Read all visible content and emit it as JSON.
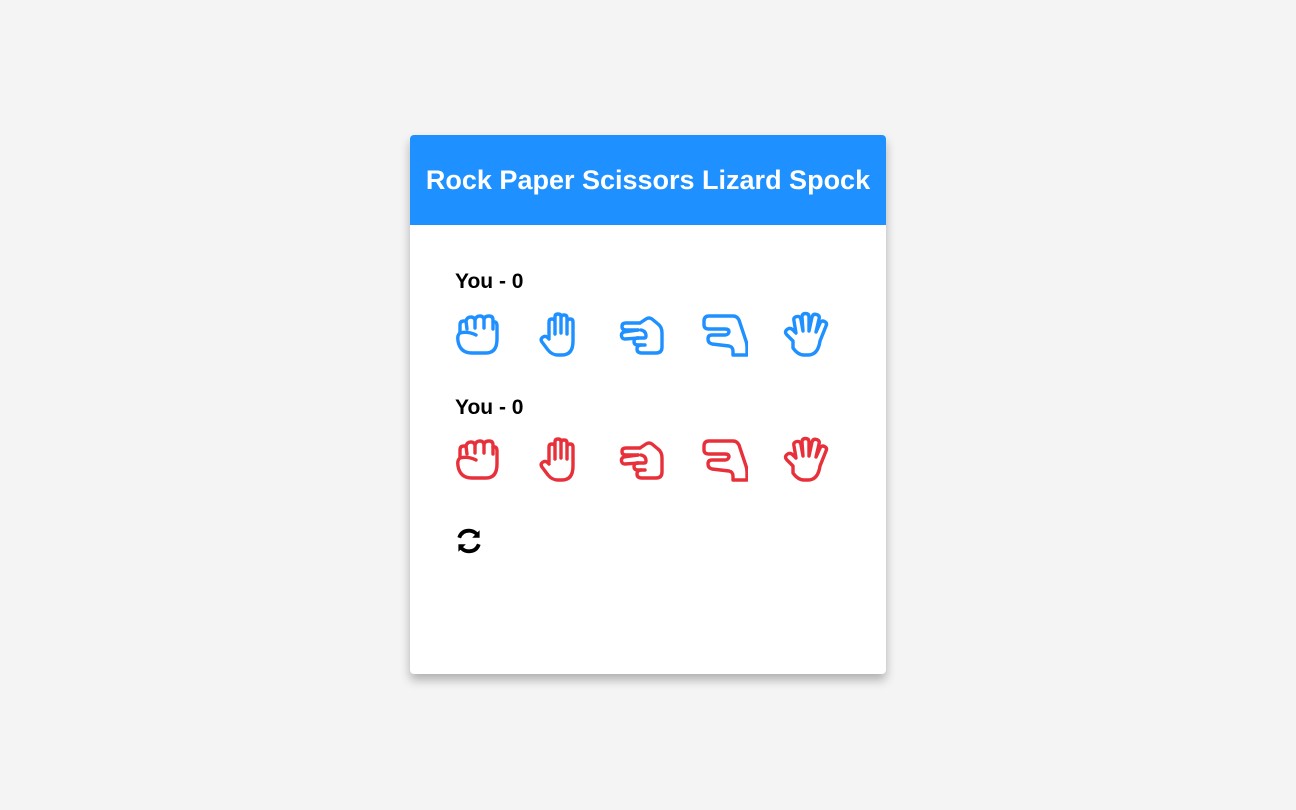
{
  "title": "Rock Paper Scissors Lizard Spock",
  "colors": {
    "header": "#1e90ff",
    "player": "#1e90ff",
    "opponent": "#e8303a",
    "background": "#f4f4f4"
  },
  "players": [
    {
      "name": "You",
      "separator": " - ",
      "score": "0",
      "hands": [
        "hand-rock-icon",
        "hand-paper-icon",
        "hand-scissors-icon",
        "hand-lizard-icon",
        "hand-spock-icon"
      ]
    },
    {
      "name": "You",
      "separator": " - ",
      "score": "0",
      "hands": [
        "hand-rock-icon",
        "hand-paper-icon",
        "hand-scissors-icon",
        "hand-lizard-icon",
        "hand-spock-icon"
      ]
    }
  ],
  "reset_icon": "refresh-icon"
}
